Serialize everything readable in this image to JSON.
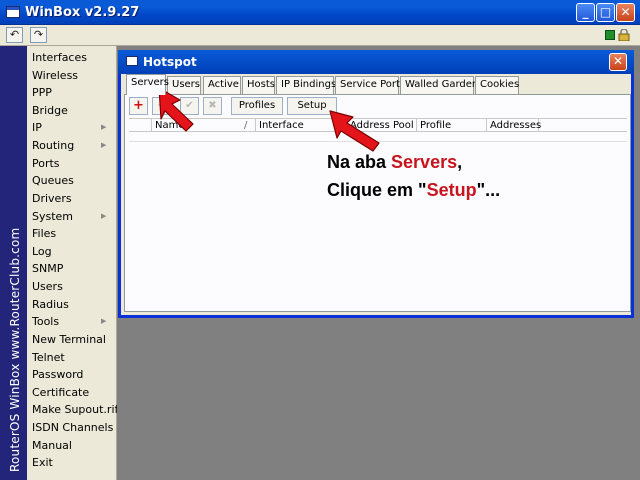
{
  "app": {
    "title": "WinBox v2.9.27",
    "min_label": "_",
    "max_label": "□",
    "close_label": "✕",
    "back_label": "↶",
    "forward_label": "↷"
  },
  "brand": {
    "vertical_text": "RouterOS WinBox   www.RouterClub.com"
  },
  "menu": {
    "items": [
      {
        "label": "Interfaces",
        "submenu": false
      },
      {
        "label": "Wireless",
        "submenu": false
      },
      {
        "label": "PPP",
        "submenu": false
      },
      {
        "label": "Bridge",
        "submenu": false
      },
      {
        "label": "IP",
        "submenu": true
      },
      {
        "label": "Routing",
        "submenu": true
      },
      {
        "label": "Ports",
        "submenu": false
      },
      {
        "label": "Queues",
        "submenu": false
      },
      {
        "label": "Drivers",
        "submenu": false
      },
      {
        "label": "System",
        "submenu": true
      },
      {
        "label": "Files",
        "submenu": false
      },
      {
        "label": "Log",
        "submenu": false
      },
      {
        "label": "SNMP",
        "submenu": false
      },
      {
        "label": "Users",
        "submenu": false
      },
      {
        "label": "Radius",
        "submenu": false
      },
      {
        "label": "Tools",
        "submenu": true
      },
      {
        "label": "New Terminal",
        "submenu": false
      },
      {
        "label": "Telnet",
        "submenu": false
      },
      {
        "label": "Password",
        "submenu": false
      },
      {
        "label": "Certificate",
        "submenu": false
      },
      {
        "label": "Make Supout.rif",
        "submenu": false
      },
      {
        "label": "ISDN Channels",
        "submenu": false
      },
      {
        "label": "Manual",
        "submenu": false
      },
      {
        "label": "Exit",
        "submenu": false
      }
    ]
  },
  "hotspot": {
    "title": "Hotspot",
    "close_label": "✕",
    "tabs": [
      "Servers",
      "Users",
      "Active",
      "Hosts",
      "IP Bindings",
      "Service Ports",
      "Walled Garden",
      "Cookies"
    ],
    "active_tab": "Servers",
    "buttons": {
      "add": "+",
      "remove": "−",
      "enable": "✔",
      "disable": "✖",
      "profiles": "Profiles",
      "setup": "Setup"
    },
    "columns": [
      "",
      "Name",
      "Interface",
      "Address Pool",
      "Profile",
      "Addresses"
    ],
    "sort_marker": "/"
  },
  "annotation": {
    "line1_prefix": "Na aba ",
    "line1_highlight": "Servers",
    "line1_suffix": ",",
    "line2_prefix": "Clique em \"",
    "line2_highlight": "Setup",
    "line2_suffix": "\"..."
  },
  "colors": {
    "titlebar_blue": "#0a5ad8",
    "brand_strip": "#23257a",
    "annotation_red": "#c8141c",
    "arrow_red": "#e3151b"
  }
}
